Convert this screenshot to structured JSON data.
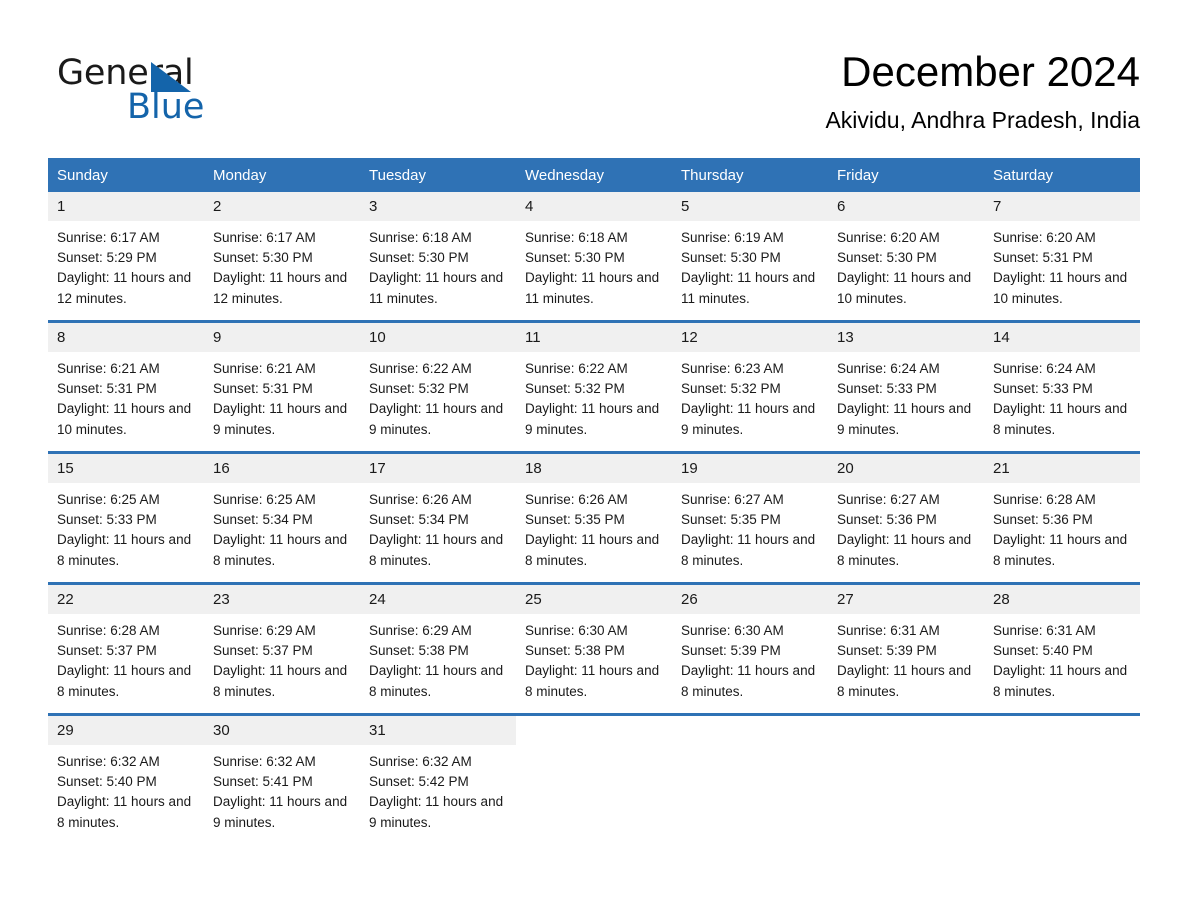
{
  "brand": {
    "name_top": "General",
    "name_bottom": "Blue",
    "accent_color": "#1464aa"
  },
  "header": {
    "title": "December 2024",
    "location": "Akividu, Andhra Pradesh, India"
  },
  "theme": {
    "header_blue": "#2f72b5",
    "daynum_band": "#f0f0f0",
    "text": "#1a1a1a"
  },
  "calendar": {
    "weekday_headers": [
      "Sunday",
      "Monday",
      "Tuesday",
      "Wednesday",
      "Thursday",
      "Friday",
      "Saturday"
    ],
    "weeks": [
      [
        {
          "day": "1",
          "sunrise": "Sunrise: 6:17 AM",
          "sunset": "Sunset: 5:29 PM",
          "daylight": "Daylight: 11 hours and 12 minutes."
        },
        {
          "day": "2",
          "sunrise": "Sunrise: 6:17 AM",
          "sunset": "Sunset: 5:30 PM",
          "daylight": "Daylight: 11 hours and 12 minutes."
        },
        {
          "day": "3",
          "sunrise": "Sunrise: 6:18 AM",
          "sunset": "Sunset: 5:30 PM",
          "daylight": "Daylight: 11 hours and 11 minutes."
        },
        {
          "day": "4",
          "sunrise": "Sunrise: 6:18 AM",
          "sunset": "Sunset: 5:30 PM",
          "daylight": "Daylight: 11 hours and 11 minutes."
        },
        {
          "day": "5",
          "sunrise": "Sunrise: 6:19 AM",
          "sunset": "Sunset: 5:30 PM",
          "daylight": "Daylight: 11 hours and 11 minutes."
        },
        {
          "day": "6",
          "sunrise": "Sunrise: 6:20 AM",
          "sunset": "Sunset: 5:30 PM",
          "daylight": "Daylight: 11 hours and 10 minutes."
        },
        {
          "day": "7",
          "sunrise": "Sunrise: 6:20 AM",
          "sunset": "Sunset: 5:31 PM",
          "daylight": "Daylight: 11 hours and 10 minutes."
        }
      ],
      [
        {
          "day": "8",
          "sunrise": "Sunrise: 6:21 AM",
          "sunset": "Sunset: 5:31 PM",
          "daylight": "Daylight: 11 hours and 10 minutes."
        },
        {
          "day": "9",
          "sunrise": "Sunrise: 6:21 AM",
          "sunset": "Sunset: 5:31 PM",
          "daylight": "Daylight: 11 hours and 9 minutes."
        },
        {
          "day": "10",
          "sunrise": "Sunrise: 6:22 AM",
          "sunset": "Sunset: 5:32 PM",
          "daylight": "Daylight: 11 hours and 9 minutes."
        },
        {
          "day": "11",
          "sunrise": "Sunrise: 6:22 AM",
          "sunset": "Sunset: 5:32 PM",
          "daylight": "Daylight: 11 hours and 9 minutes."
        },
        {
          "day": "12",
          "sunrise": "Sunrise: 6:23 AM",
          "sunset": "Sunset: 5:32 PM",
          "daylight": "Daylight: 11 hours and 9 minutes."
        },
        {
          "day": "13",
          "sunrise": "Sunrise: 6:24 AM",
          "sunset": "Sunset: 5:33 PM",
          "daylight": "Daylight: 11 hours and 9 minutes."
        },
        {
          "day": "14",
          "sunrise": "Sunrise: 6:24 AM",
          "sunset": "Sunset: 5:33 PM",
          "daylight": "Daylight: 11 hours and 8 minutes."
        }
      ],
      [
        {
          "day": "15",
          "sunrise": "Sunrise: 6:25 AM",
          "sunset": "Sunset: 5:33 PM",
          "daylight": "Daylight: 11 hours and 8 minutes."
        },
        {
          "day": "16",
          "sunrise": "Sunrise: 6:25 AM",
          "sunset": "Sunset: 5:34 PM",
          "daylight": "Daylight: 11 hours and 8 minutes."
        },
        {
          "day": "17",
          "sunrise": "Sunrise: 6:26 AM",
          "sunset": "Sunset: 5:34 PM",
          "daylight": "Daylight: 11 hours and 8 minutes."
        },
        {
          "day": "18",
          "sunrise": "Sunrise: 6:26 AM",
          "sunset": "Sunset: 5:35 PM",
          "daylight": "Daylight: 11 hours and 8 minutes."
        },
        {
          "day": "19",
          "sunrise": "Sunrise: 6:27 AM",
          "sunset": "Sunset: 5:35 PM",
          "daylight": "Daylight: 11 hours and 8 minutes."
        },
        {
          "day": "20",
          "sunrise": "Sunrise: 6:27 AM",
          "sunset": "Sunset: 5:36 PM",
          "daylight": "Daylight: 11 hours and 8 minutes."
        },
        {
          "day": "21",
          "sunrise": "Sunrise: 6:28 AM",
          "sunset": "Sunset: 5:36 PM",
          "daylight": "Daylight: 11 hours and 8 minutes."
        }
      ],
      [
        {
          "day": "22",
          "sunrise": "Sunrise: 6:28 AM",
          "sunset": "Sunset: 5:37 PM",
          "daylight": "Daylight: 11 hours and 8 minutes."
        },
        {
          "day": "23",
          "sunrise": "Sunrise: 6:29 AM",
          "sunset": "Sunset: 5:37 PM",
          "daylight": "Daylight: 11 hours and 8 minutes."
        },
        {
          "day": "24",
          "sunrise": "Sunrise: 6:29 AM",
          "sunset": "Sunset: 5:38 PM",
          "daylight": "Daylight: 11 hours and 8 minutes."
        },
        {
          "day": "25",
          "sunrise": "Sunrise: 6:30 AM",
          "sunset": "Sunset: 5:38 PM",
          "daylight": "Daylight: 11 hours and 8 minutes."
        },
        {
          "day": "26",
          "sunrise": "Sunrise: 6:30 AM",
          "sunset": "Sunset: 5:39 PM",
          "daylight": "Daylight: 11 hours and 8 minutes."
        },
        {
          "day": "27",
          "sunrise": "Sunrise: 6:31 AM",
          "sunset": "Sunset: 5:39 PM",
          "daylight": "Daylight: 11 hours and 8 minutes."
        },
        {
          "day": "28",
          "sunrise": "Sunrise: 6:31 AM",
          "sunset": "Sunset: 5:40 PM",
          "daylight": "Daylight: 11 hours and 8 minutes."
        }
      ],
      [
        {
          "day": "29",
          "sunrise": "Sunrise: 6:32 AM",
          "sunset": "Sunset: 5:40 PM",
          "daylight": "Daylight: 11 hours and 8 minutes."
        },
        {
          "day": "30",
          "sunrise": "Sunrise: 6:32 AM",
          "sunset": "Sunset: 5:41 PM",
          "daylight": "Daylight: 11 hours and 9 minutes."
        },
        {
          "day": "31",
          "sunrise": "Sunrise: 6:32 AM",
          "sunset": "Sunset: 5:42 PM",
          "daylight": "Daylight: 11 hours and 9 minutes."
        },
        {
          "day": "",
          "sunrise": "",
          "sunset": "",
          "daylight": ""
        },
        {
          "day": "",
          "sunrise": "",
          "sunset": "",
          "daylight": ""
        },
        {
          "day": "",
          "sunrise": "",
          "sunset": "",
          "daylight": ""
        },
        {
          "day": "",
          "sunrise": "",
          "sunset": "",
          "daylight": ""
        }
      ]
    ]
  }
}
